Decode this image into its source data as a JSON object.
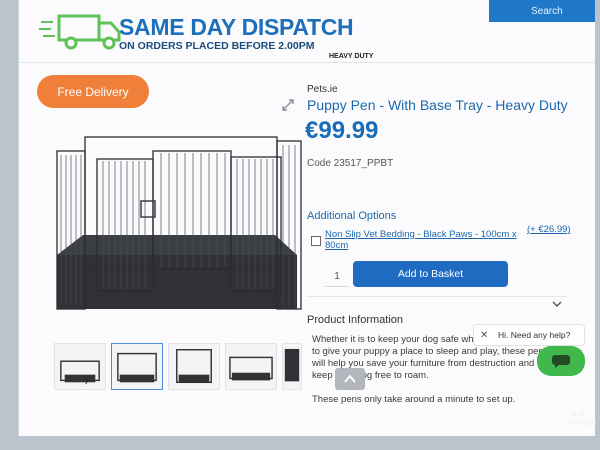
{
  "header": {
    "search_label": "Search",
    "dispatch_title": "SAME DAY DISPATCH",
    "dispatch_subtitle": "ON ORDERS PLACED BEFORE 2.00PM",
    "category_label": "HEAVY DUTY"
  },
  "badge": {
    "label": "Free Delivery",
    "color": "#ef7f39"
  },
  "product": {
    "brand": "Pets.ie",
    "title": "Puppy Pen - With Base Tray - Heavy Duty",
    "price": "€99.99",
    "code": "Code 23517_PPBT",
    "accent_color": "#1d68ae"
  },
  "options": {
    "title": "Additional Options",
    "items": [
      {
        "name": "Non Slip Vet Bedding - Black Paws - 100cm x 80cm",
        "price": "(+ €26.99)",
        "checked": false
      }
    ]
  },
  "purchase": {
    "quantity": "1",
    "add_to_basket_label": "Add to Basket",
    "button_color": "#1e6bc1"
  },
  "product_information": {
    "title": "Product Information",
    "paragraphs": [
      "Whether it is to keep your dog safe while you are out, or to give your puppy a place to sleep and play, these pens will help you save your furniture from destruction and keep your dog free to roam.",
      "These pens only take around a minute to set up."
    ]
  },
  "chat": {
    "close_icon": "close-icon",
    "prompt": "Hi. Need any help?",
    "button_color": "#41b84c"
  },
  "gallery": {
    "thumbnail_count": 5,
    "active_index": 1
  },
  "taskbar": {
    "time": "14:18",
    "date": "10/04/2025"
  }
}
